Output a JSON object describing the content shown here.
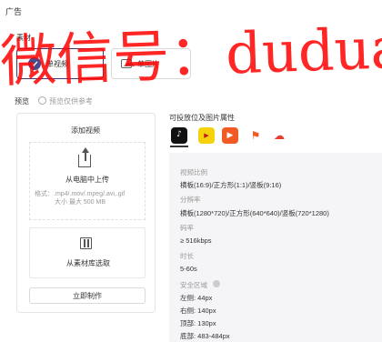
{
  "section": {
    "title": "广告",
    "material_label": "素材",
    "preview_label": "预览",
    "preview_option": "预览仅供参考"
  },
  "material_options": [
    {
      "label": "单视频",
      "selected": true
    },
    {
      "label": "单图片",
      "selected": false
    }
  ],
  "upload": {
    "panel_title": "添加视频",
    "upload_title": "从电脑中上传",
    "formats": "格式：.mp4/.mov/.mpeg/.avi,.gif",
    "size_limit": "大小 最大 500 MB",
    "library_label": "从素材库选取",
    "make_button": "立即制作"
  },
  "attributes": {
    "title": "可投放位及图片属性",
    "platforms": [
      {
        "icon": "douyin-icon",
        "color": "#111111"
      },
      {
        "icon": "kuaishou-icon",
        "color": "#f5d20b"
      },
      {
        "icon": "video-app-icon",
        "color": "#f15a24"
      },
      {
        "icon": "flag-app-icon",
        "color": "#f15a24"
      },
      {
        "icon": "cloud-app-icon",
        "color": "#e63b2e"
      }
    ],
    "items": [
      {
        "key": "视频比例",
        "value": "横板(16:9)/正方形(1:1)/竖板(9:16)"
      },
      {
        "key": "分辨率",
        "value": "横板(1280*720)/正方形(640*640)/竖板(720*1280)"
      },
      {
        "key": "码率",
        "value": "≥ 516kbps"
      },
      {
        "key": "时长",
        "value": "5-60s"
      }
    ],
    "safe_area": {
      "label": "安全区域",
      "values": [
        "左侧: 44px",
        "右侧: 140px",
        "顶部: 130px",
        "底部: 483-484px"
      ]
    }
  },
  "watermark": "微信号：duduanide",
  "colors": {
    "accent": "#4a4a8a",
    "watermark": "#ff0000"
  }
}
